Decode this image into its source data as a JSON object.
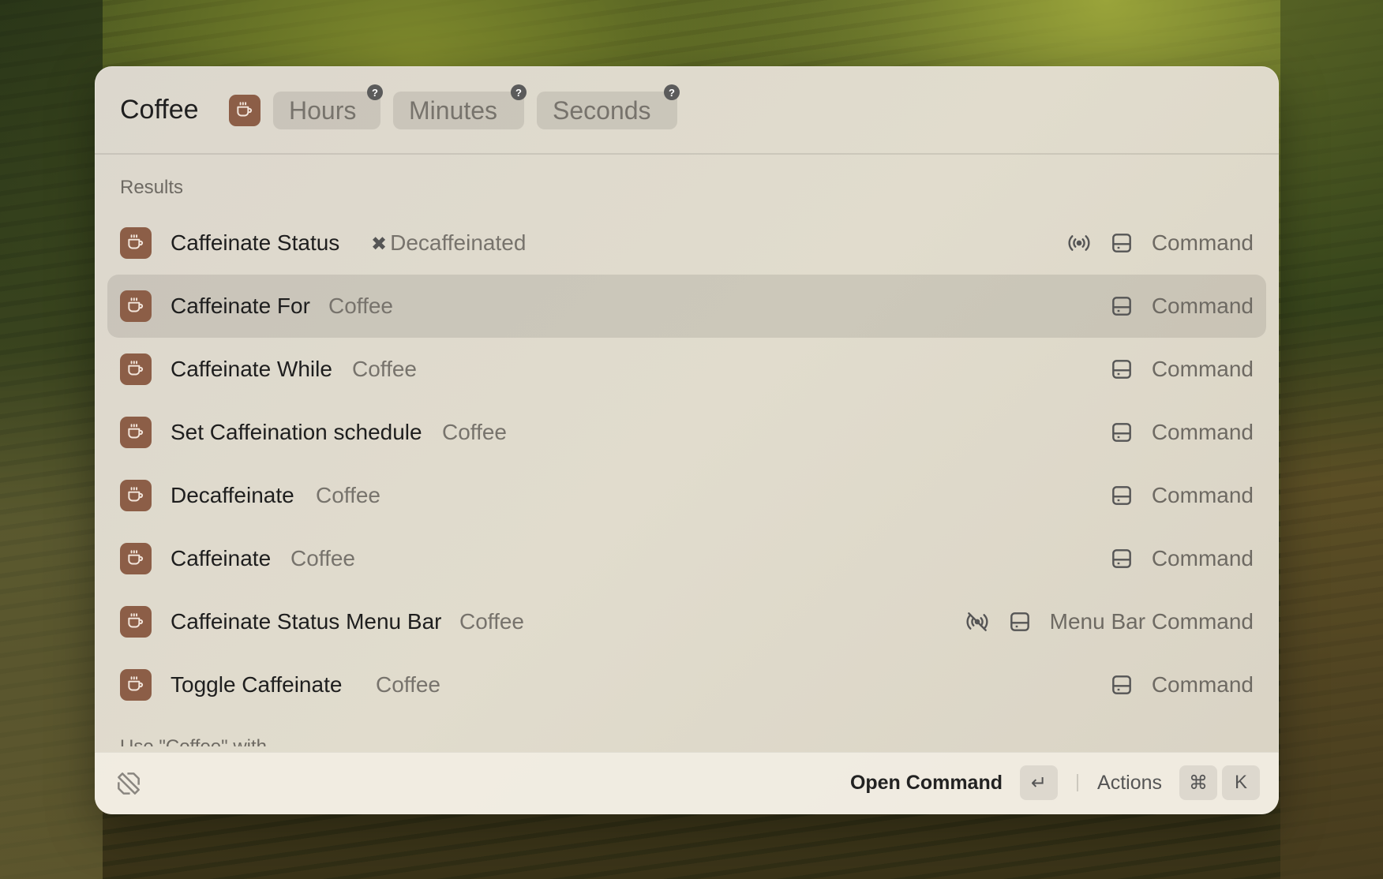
{
  "search": {
    "title": "Coffee",
    "arguments": [
      {
        "label": "Hours",
        "help": "?"
      },
      {
        "label": "Minutes",
        "help": "?"
      },
      {
        "label": "Seconds",
        "help": "?"
      }
    ]
  },
  "results": {
    "section_label": "Results",
    "items": [
      {
        "title": "Caffeinate Status",
        "subtitle": "Decaffeinated",
        "subtitle_prefix": "✖",
        "kind": "Command",
        "accessory": "broadcast-icon",
        "selected": false
      },
      {
        "title": "Caffeinate For",
        "subtitle": "Coffee",
        "kind": "Command",
        "selected": true
      },
      {
        "title": "Caffeinate While",
        "subtitle": "Coffee",
        "kind": "Command",
        "selected": false
      },
      {
        "title": "Set Caffeination schedule",
        "subtitle": "Coffee",
        "kind": "Command",
        "selected": false
      },
      {
        "title": "Decaffeinate",
        "subtitle": "Coffee",
        "kind": "Command",
        "selected": false
      },
      {
        "title": "Caffeinate",
        "subtitle": "Coffee",
        "kind": "Command",
        "selected": false
      },
      {
        "title": "Caffeinate Status Menu Bar",
        "subtitle": "Coffee",
        "kind": "Menu Bar Command",
        "accessory": "broadcast-off-icon",
        "selected": false
      },
      {
        "title": "Toggle Caffeinate",
        "subtitle": "Coffee",
        "kind": "Command",
        "selected": false
      }
    ],
    "next_section_label": "Use \"Coffee\" with..."
  },
  "footer": {
    "primary_action": "Open Command",
    "primary_key": "↵",
    "actions_label": "Actions",
    "actions_keys": [
      "⌘",
      "K"
    ]
  },
  "colors": {
    "app_icon_bg": "#8c5e47",
    "selection_bg": "rgba(0,0,0,0.09)"
  }
}
